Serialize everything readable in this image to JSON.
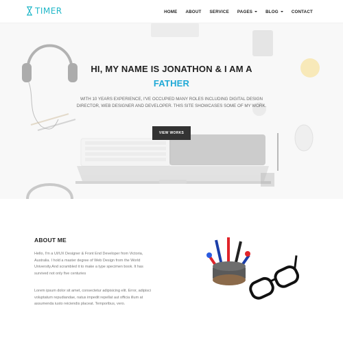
{
  "brand": {
    "name": "TIMER",
    "accent_color": "#20b7c8"
  },
  "nav": {
    "items": [
      {
        "label": "HOME",
        "has_dropdown": false
      },
      {
        "label": "ABOUT",
        "has_dropdown": false
      },
      {
        "label": "SERVICE",
        "has_dropdown": false
      },
      {
        "label": "PAGES",
        "has_dropdown": true
      },
      {
        "label": "BLOG",
        "has_dropdown": true
      },
      {
        "label": "CONTACT",
        "has_dropdown": false
      }
    ]
  },
  "hero": {
    "title": "HI, MY NAME IS JONATHON & I AM A",
    "highlight": "FATHER",
    "highlight_color": "#1fa9d6",
    "description": "WITH 10 YEARS EXPERIENCE, I'VE OCCUPIED MANY ROLES INCLUDING DIGITAL DESIGN DIRECTOR, WEB DESIGNER AND DEVELOPER. THIS SITE SHOWCASES SOME OF MY WORK.",
    "button_label": "VIEW WORKS",
    "background_icons": [
      "headphones-icon",
      "keyboard-icon",
      "laptop-icon",
      "mouse-icon",
      "pencil-icon",
      "cup-icon"
    ]
  },
  "about": {
    "title": "ABOUT ME",
    "paragraph1": "Hello, I'm a UI/UX Designer & Front End Developer from Victoria, Australia. I hold a master degree of Web Design from the World University.And scrambled it to make a type specimen book. It has survived not only five centuries",
    "paragraph2": "Lorem ipsum dolor sit amet, consectetur adipisicing elit. Error, adipisci voluptatum repudiandae, natus impedit repellat aut officia illum at assumenda iusto reiciendis placeat. Temporibus, vero.",
    "illustration_icons": [
      "pen-holder-icon",
      "glasses-icon"
    ]
  }
}
